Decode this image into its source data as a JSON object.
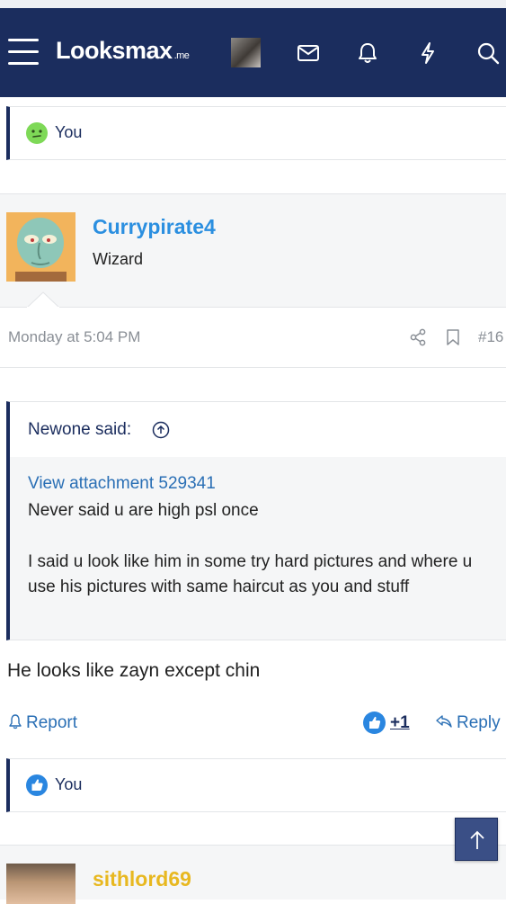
{
  "header": {
    "brand": "Lᴏᴏksmax",
    "brand_suffix": ".me",
    "icons": [
      "menu-icon",
      "avatar",
      "mail-icon",
      "bell-icon",
      "bolt-icon",
      "search-icon"
    ],
    "background": "#1b2d5e"
  },
  "top_reactions": {
    "emoji": "neutral-face-icon",
    "label": "You"
  },
  "post": {
    "author": "Currypirate4",
    "author_title": "Wizard",
    "date": "Monday at 5:04 PM",
    "post_number": "#16",
    "quote": {
      "title": "Newone said:",
      "attachment_link": "View attachment 529341",
      "lines": [
        "Never said u are high psl once",
        "I said u look like him in some try hard pictures and where u use his pictures with same haircut as you and stuff"
      ]
    },
    "body": "He looks like zayn except chin",
    "actions": {
      "report": "Report",
      "reaction_count": "+1",
      "reply": "Reply"
    },
    "reactions": {
      "emoji": "thumbs-up-icon",
      "label": "You"
    }
  },
  "next_post": {
    "author": "sithlord69"
  },
  "colors": {
    "accent_blue": "#2a6fb5",
    "username_blue": "#2b8fe0",
    "username_gold": "#e8b820"
  }
}
